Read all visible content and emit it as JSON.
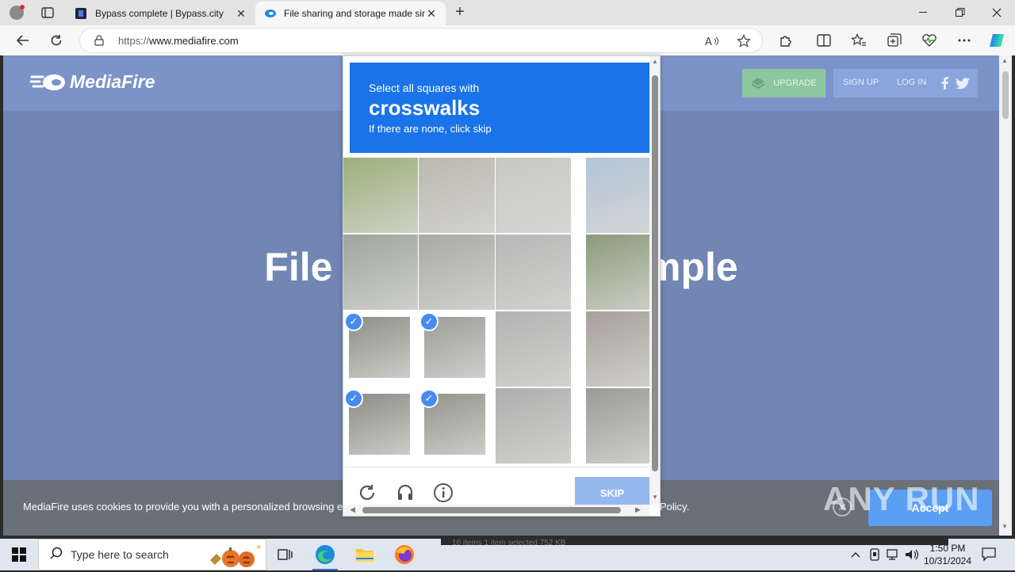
{
  "browser": {
    "tabs": [
      {
        "title": "Bypass complete | Bypass.city",
        "active": false
      },
      {
        "title": "File sharing and storage made simple",
        "active": true
      }
    ],
    "url_prefix": "https://",
    "url_host": "www.mediafire.com",
    "new_tab": "+",
    "close_glyph": "✕"
  },
  "page": {
    "logo_text": "MediaFire",
    "upgrade": "UPGRADE",
    "signup": "SIGN UP",
    "login": "LOG IN",
    "hero_title": "File storage made simple",
    "cookie_text": "MediaFire uses cookies to provide you with a personalized browsing experience. By continuing to use this site, you agree to our Privacy",
    "cookie_policy": "Policy.",
    "accept": "Accept"
  },
  "captcha": {
    "instruction_line1": "Select all squares with",
    "instruction_target": "crosswalks",
    "instruction_line3": "If there are none, click skip",
    "skip": "SKIP",
    "check": "✓",
    "tiles": [
      {
        "id": "r1c1",
        "selected": false,
        "color": "#9bb07a"
      },
      {
        "id": "r1c2",
        "selected": false,
        "color": "#b9b9ae"
      },
      {
        "id": "r1c3",
        "selected": false,
        "color": "#c9c9c4"
      },
      {
        "id": "r1c4",
        "selected": false,
        "color": "#b4c4d8"
      },
      {
        "id": "r2c1",
        "selected": false,
        "color": "#9fa59c"
      },
      {
        "id": "r2c2",
        "selected": false,
        "color": "#a9aaa8"
      },
      {
        "id": "r2c3",
        "selected": false,
        "color": "#b6b7b6"
      },
      {
        "id": "r2c4",
        "selected": false,
        "color": "#8a9a7a"
      },
      {
        "id": "r3c1",
        "selected": true,
        "color": "#8e8f88"
      },
      {
        "id": "r3c2",
        "selected": true,
        "color": "#9c9d98"
      },
      {
        "id": "r3c3",
        "selected": false,
        "color": "#b2b3b2"
      },
      {
        "id": "r3c4",
        "selected": false,
        "color": "#a6a09d"
      },
      {
        "id": "r4c1",
        "selected": true,
        "color": "#8c8d86"
      },
      {
        "id": "r4c2",
        "selected": true,
        "color": "#94948c"
      },
      {
        "id": "r4c3",
        "selected": false,
        "color": "#aeaeae"
      },
      {
        "id": "r4c4",
        "selected": false,
        "color": "#9a9a98"
      }
    ]
  },
  "watermark": "ANY RUN",
  "taskbar": {
    "search_placeholder": "Type here to search",
    "time": "1:50 PM",
    "date": "10/31/2024",
    "behind_text": "16 items     1 item selected  752 KB"
  },
  "colors": {
    "captcha_header": "#1a73e8",
    "page_bg": "#7186b4",
    "accept": "#5b9ff4"
  }
}
